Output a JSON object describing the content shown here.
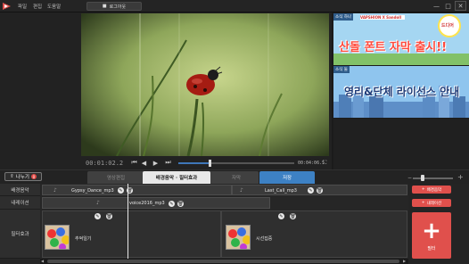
{
  "menu": [
    "파일",
    "편집",
    "도움말"
  ],
  "login_button": "로그아웃",
  "window_controls": {
    "minimize": "—",
    "maximize": "□",
    "close": "✕"
  },
  "player": {
    "current_time": "00:01:02.2",
    "total_time": "00:04:06.5",
    "progress": 0.27
  },
  "ads": {
    "ad1": {
      "tag": "소식 하나",
      "brand": "VAPSHION X Sandoll",
      "badge": "드디어",
      "headline": "산돌 폰트 자막 출시!!"
    },
    "ad2": {
      "tag": "소식 둘",
      "headline": "영리&단체 라이선스 안내"
    }
  },
  "share": {
    "label": "나누기",
    "badge": "0"
  },
  "tabs": [
    "영상편집",
    "배경음악 · 필터효과",
    "자막",
    "저장"
  ],
  "active_tab": "배경음악 · 필터효과",
  "zoom": {
    "level": 0.2
  },
  "tracks": {
    "bgm": {
      "label": "배경음악",
      "clips": [
        "Gypsy_Dance_mp3",
        "Last_Call_mp3"
      ]
    },
    "narration": {
      "label": "내레이션",
      "clips": [
        "voice2016_mp3"
      ]
    },
    "filter": {
      "label": "필터효과",
      "clips": [
        "추억일기",
        "시선집중"
      ]
    }
  },
  "right_panel": {
    "add_bgm": "배경음악",
    "add_narration": "내레이션",
    "add_filter": "필터"
  },
  "colors": {
    "accent_blue": "#3d81c4",
    "accent_red": "#e0504c"
  }
}
